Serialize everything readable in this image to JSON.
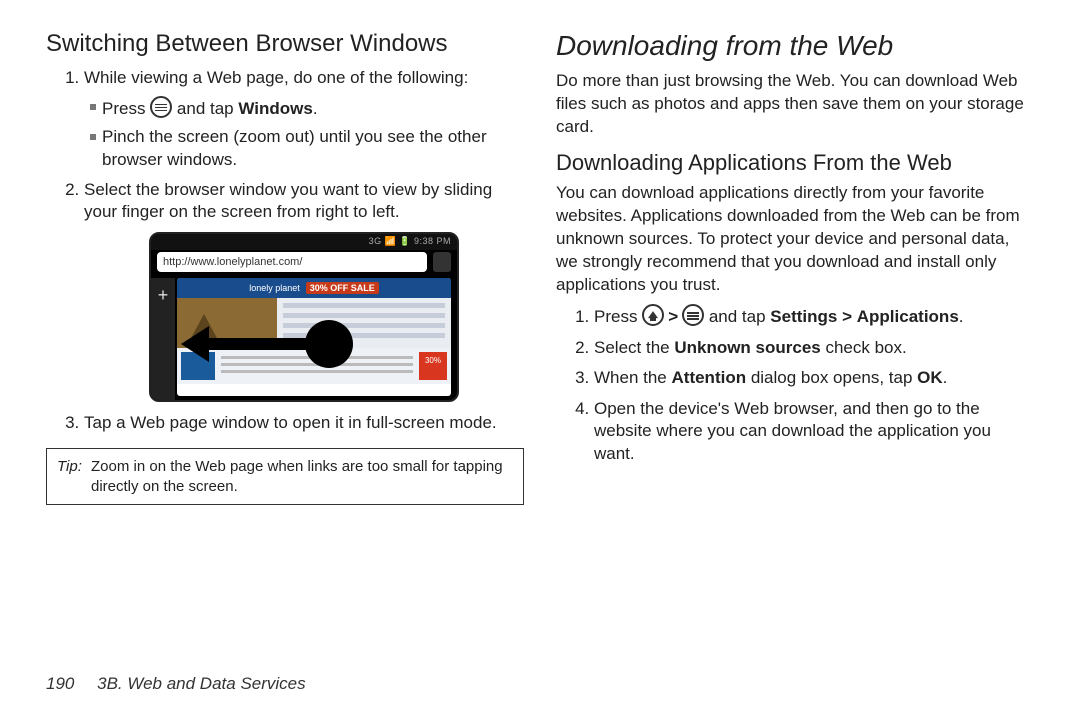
{
  "left": {
    "heading": "Switching Between Browser Windows",
    "step1": "While viewing a Web page, do one of the following:",
    "step1a_pre": "Press ",
    "step1a_mid": " and tap ",
    "step1a_bold": "Windows",
    "step1a_post": ".",
    "step1b": "Pinch the screen (zoom out) until you see the other browser windows.",
    "step2": "Select the browser window you want to view by sliding your finger on the screen from right to left.",
    "step3": "Tap a Web page window to open it in full-screen mode.",
    "screenshot": {
      "status": "3G 📶 🔋 9:38 PM",
      "url": "http://www.lonelyplanet.com/",
      "banner_text": "30% OFF SALE",
      "thumb_text": "30%"
    },
    "tip_label": "Tip:",
    "tip_text": "Zoom in on the Web page when links are too small for tapping directly on the screen."
  },
  "right": {
    "main_heading": "Downloading from the Web",
    "intro": "Do more than just browsing the Web. You can download Web files such as photos and apps then save them on your storage card.",
    "sub_heading": "Downloading Applications From the Web",
    "sub_intro": "You can download applications directly from your favorite websites. Applications downloaded from the Web can be from unknown sources. To protect your device and personal data, we strongly recommend that you download and install only applications you trust.",
    "s1_pre": "Press ",
    "s1_mid": " and tap ",
    "s1_bold1": "Settings",
    "s1_gt": ">",
    "s1_bold2": "Applications",
    "s1_post": ".",
    "s2_pre": "Select the ",
    "s2_bold": "Unknown sources",
    "s2_post": " check box.",
    "s3_pre": "When the ",
    "s3_bold1": "Attention",
    "s3_mid": " dialog box opens, tap ",
    "s3_bold2": "OK",
    "s3_post": ".",
    "s4": "Open the device's Web browser, and then go to the website where you can download the application you want."
  },
  "footer": {
    "page_number": "190",
    "section": "3B. Web and Data Services"
  }
}
